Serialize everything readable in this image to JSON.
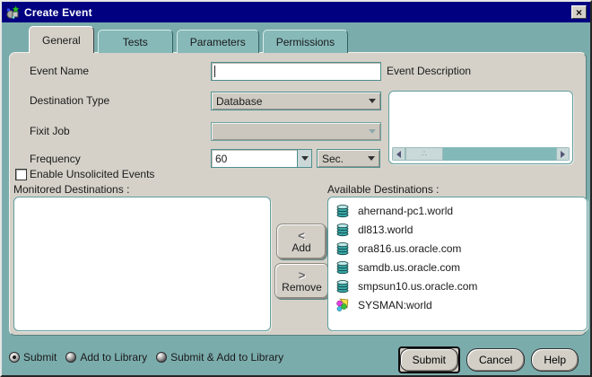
{
  "window": {
    "title": "Create Event",
    "close_glyph": "×"
  },
  "tabs": [
    {
      "label": "General",
      "active": true
    },
    {
      "label": "Tests",
      "active": false
    },
    {
      "label": "Parameters",
      "active": false
    },
    {
      "label": "Permissions",
      "active": false
    }
  ],
  "form": {
    "event_name_label": "Event Name",
    "event_name_value": "",
    "event_description_label": "Event Description",
    "destination_type_label": "Destination Type",
    "destination_type_value": "Database",
    "fixit_job_label": "Fixit Job",
    "fixit_job_value": "",
    "frequency_label": "Frequency",
    "frequency_value": "60",
    "frequency_unit_value": "Sec.",
    "enable_unsolicited_label": "Enable Unsolicited Events"
  },
  "monitored": {
    "label": "Monitored Destinations :",
    "items": []
  },
  "available": {
    "label": "Available Destinations :",
    "items": [
      {
        "name": "ahernand-pc1.world",
        "icon": "database-icon"
      },
      {
        "name": "dl813.world",
        "icon": "database-icon"
      },
      {
        "name": "ora816.us.oracle.com",
        "icon": "database-icon"
      },
      {
        "name": "samdb.us.oracle.com",
        "icon": "database-icon"
      },
      {
        "name": "smpsun10.us.oracle.com",
        "icon": "database-icon"
      },
      {
        "name": "SYSMAN:world",
        "icon": "group-icon"
      }
    ]
  },
  "transfer": {
    "add_glyph": "<",
    "add_label": "Add",
    "remove_glyph": ">",
    "remove_label": "Remove"
  },
  "footer": {
    "radios": [
      {
        "label": "Submit",
        "selected": true
      },
      {
        "label": "Add to Library",
        "selected": false
      },
      {
        "label": "Submit & Add to Library",
        "selected": false
      }
    ],
    "buttons": [
      {
        "label": "Submit",
        "default": true
      },
      {
        "label": "Cancel",
        "default": false
      },
      {
        "label": "Help",
        "default": false
      }
    ]
  },
  "colors": {
    "titlebar": "#000080",
    "teal": "#7BACAC",
    "footer-teal": "#7D9B9B",
    "panel": "#D5D1C9",
    "tab-inactive": "#87B9B9",
    "border-teal": "#4E8E8E",
    "listbox-border": "#5F9F9F",
    "scrollbar": "#82B8B8"
  }
}
